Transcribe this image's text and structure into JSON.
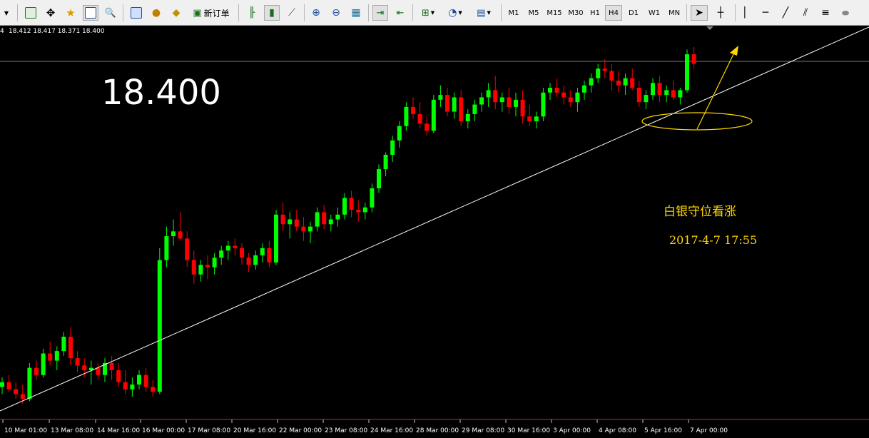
{
  "toolbar": {
    "new_order_label": "新订单",
    "timeframes": [
      "M1",
      "M5",
      "M15",
      "M30",
      "H1",
      "H4",
      "D1",
      "W1",
      "MN"
    ],
    "active_timeframe": "H4"
  },
  "chart": {
    "ohlc_header": "18.412 18.417 18.371 18.400",
    "ohlc_prefix": "4",
    "big_price": "18.400",
    "annotation_text": "白银守位看涨",
    "annotation_time": "2017-4-7   17:55",
    "x_tick_labels": [
      "10 Mar 01:00",
      "13 Mar 08:00",
      "14 Mar 16:00",
      "16 Mar 00:00",
      "17 Mar 08:00",
      "20 Mar 16:00",
      "22 Mar 00:00",
      "23 Mar 08:00",
      "24 Mar 16:00",
      "28 Mar 00:00",
      "29 Mar 08:00",
      "30 Mar 16:00",
      "3 Apr 00:00",
      "4 Apr 08:00",
      "5 Apr 16:00",
      "7 Apr 00:00"
    ],
    "colors": {
      "bull": "#00ff00",
      "bear": "#ff0000",
      "annotation": "#ffd700",
      "background": "#000000",
      "trendline": "#ffffff"
    }
  },
  "chart_data": {
    "type": "candlestick",
    "instrument_note": "silver H4",
    "current_price": 18.4,
    "price_line": 18.4,
    "last_bar": {
      "open": 18.412,
      "high": 18.417,
      "low": 18.371,
      "close": 18.4
    },
    "x_labels": [
      "10 Mar 01:00",
      "13 Mar 08:00",
      "14 Mar 16:00",
      "16 Mar 00:00",
      "17 Mar 08:00",
      "20 Mar 16:00",
      "22 Mar 00:00",
      "23 Mar 08:00",
      "24 Mar 16:00",
      "28 Mar 00:00",
      "29 Mar 08:00",
      "30 Mar 16:00",
      "3 Apr 00:00",
      "4 Apr 08:00",
      "5 Apr 16:00",
      "7 Apr 00:00"
    ],
    "candles": [
      [
        17.05,
        17.09,
        17.02,
        17.07
      ],
      [
        17.07,
        17.1,
        17.03,
        17.04
      ],
      [
        17.04,
        17.07,
        17.0,
        17.02
      ],
      [
        17.02,
        17.06,
        16.98,
        17.0
      ],
      [
        17.0,
        17.15,
        16.99,
        17.13
      ],
      [
        17.13,
        17.16,
        17.08,
        17.1
      ],
      [
        17.1,
        17.21,
        17.09,
        17.19
      ],
      [
        17.19,
        17.24,
        17.14,
        17.16
      ],
      [
        17.16,
        17.22,
        17.12,
        17.2
      ],
      [
        17.2,
        17.28,
        17.18,
        17.26
      ],
      [
        17.26,
        17.3,
        17.14,
        17.17
      ],
      [
        17.17,
        17.2,
        17.11,
        17.14
      ],
      [
        17.14,
        17.17,
        17.09,
        17.12
      ],
      [
        17.12,
        17.16,
        17.06,
        17.13
      ],
      [
        17.13,
        17.15,
        17.08,
        17.1
      ],
      [
        17.1,
        17.17,
        17.07,
        17.15
      ],
      [
        17.15,
        17.18,
        17.08,
        17.12
      ],
      [
        17.12,
        17.15,
        17.05,
        17.07
      ],
      [
        17.07,
        17.12,
        17.02,
        17.04
      ],
      [
        17.04,
        17.09,
        17.01,
        17.06
      ],
      [
        17.06,
        17.12,
        17.04,
        17.1
      ],
      [
        17.1,
        17.13,
        17.03,
        17.05
      ],
      [
        17.05,
        17.08,
        17.01,
        17.03
      ],
      [
        17.03,
        17.63,
        17.02,
        17.58
      ],
      [
        17.58,
        17.72,
        17.55,
        17.68
      ],
      [
        17.68,
        17.75,
        17.64,
        17.7
      ],
      [
        17.7,
        17.78,
        17.66,
        17.67
      ],
      [
        17.67,
        17.7,
        17.55,
        17.58
      ],
      [
        17.58,
        17.62,
        17.48,
        17.52
      ],
      [
        17.52,
        17.58,
        17.49,
        17.56
      ],
      [
        17.56,
        17.6,
        17.5,
        17.55
      ],
      [
        17.55,
        17.61,
        17.52,
        17.59
      ],
      [
        17.59,
        17.64,
        17.56,
        17.62
      ],
      [
        17.62,
        17.66,
        17.58,
        17.64
      ],
      [
        17.64,
        17.67,
        17.6,
        17.63
      ],
      [
        17.63,
        17.65,
        17.56,
        17.59
      ],
      [
        17.59,
        17.61,
        17.53,
        17.56
      ],
      [
        17.56,
        17.62,
        17.54,
        17.6
      ],
      [
        17.6,
        17.65,
        17.57,
        17.63
      ],
      [
        17.63,
        17.66,
        17.55,
        17.57
      ],
      [
        17.57,
        17.79,
        17.56,
        17.77
      ],
      [
        17.77,
        17.82,
        17.7,
        17.73
      ],
      [
        17.73,
        17.78,
        17.67,
        17.75
      ],
      [
        17.75,
        17.79,
        17.7,
        17.72
      ],
      [
        17.72,
        17.76,
        17.66,
        17.7
      ],
      [
        17.7,
        17.74,
        17.65,
        17.72
      ],
      [
        17.72,
        17.8,
        17.7,
        17.78
      ],
      [
        17.78,
        17.81,
        17.71,
        17.73
      ],
      [
        17.73,
        17.77,
        17.7,
        17.75
      ],
      [
        17.75,
        17.8,
        17.72,
        17.77
      ],
      [
        17.77,
        17.86,
        17.75,
        17.84
      ],
      [
        17.84,
        17.87,
        17.76,
        17.79
      ],
      [
        17.79,
        17.83,
        17.74,
        17.78
      ],
      [
        17.78,
        17.82,
        17.75,
        17.8
      ],
      [
        17.8,
        17.9,
        17.78,
        17.88
      ],
      [
        17.88,
        17.98,
        17.86,
        17.96
      ],
      [
        17.96,
        18.03,
        17.93,
        18.02
      ],
      [
        18.02,
        18.1,
        17.99,
        18.08
      ],
      [
        18.08,
        18.16,
        18.05,
        18.14
      ],
      [
        18.14,
        18.24,
        18.12,
        18.22
      ],
      [
        18.22,
        18.26,
        18.17,
        18.19
      ],
      [
        18.19,
        18.24,
        18.13,
        18.15
      ],
      [
        18.15,
        18.18,
        18.1,
        18.12
      ],
      [
        18.12,
        18.27,
        18.11,
        18.25
      ],
      [
        18.25,
        18.31,
        18.22,
        18.27
      ],
      [
        18.27,
        18.3,
        18.18,
        18.2
      ],
      [
        18.2,
        18.28,
        18.17,
        18.26
      ],
      [
        18.26,
        18.29,
        18.14,
        18.16
      ],
      [
        18.16,
        18.21,
        18.13,
        18.19
      ],
      [
        18.19,
        18.25,
        18.16,
        18.23
      ],
      [
        18.23,
        18.28,
        18.2,
        18.26
      ],
      [
        18.26,
        18.32,
        18.22,
        18.29
      ],
      [
        18.29,
        18.35,
        18.21,
        18.24
      ],
      [
        18.24,
        18.28,
        18.2,
        18.26
      ],
      [
        18.26,
        18.3,
        18.19,
        18.22
      ],
      [
        18.22,
        18.28,
        18.18,
        18.25
      ],
      [
        18.25,
        18.29,
        18.15,
        18.18
      ],
      [
        18.18,
        18.23,
        18.14,
        18.16
      ],
      [
        18.16,
        18.2,
        18.13,
        18.18
      ],
      [
        18.18,
        18.3,
        18.16,
        18.28
      ],
      [
        18.28,
        18.32,
        18.25,
        18.3
      ],
      [
        18.3,
        18.34,
        18.26,
        18.28
      ],
      [
        18.28,
        18.31,
        18.23,
        18.26
      ],
      [
        18.26,
        18.29,
        18.22,
        18.24
      ],
      [
        18.24,
        18.3,
        18.2,
        18.28
      ],
      [
        18.28,
        18.33,
        18.25,
        18.31
      ],
      [
        18.31,
        18.36,
        18.28,
        18.34
      ],
      [
        18.34,
        18.4,
        18.32,
        18.38
      ],
      [
        18.38,
        18.42,
        18.34,
        18.37
      ],
      [
        18.37,
        18.4,
        18.29,
        18.33
      ],
      [
        18.33,
        18.37,
        18.28,
        18.31
      ],
      [
        18.31,
        18.36,
        18.27,
        18.34
      ],
      [
        18.34,
        18.38,
        18.29,
        18.3
      ],
      [
        18.3,
        18.33,
        18.22,
        18.24
      ],
      [
        18.24,
        18.29,
        18.21,
        18.27
      ],
      [
        18.27,
        18.34,
        18.25,
        18.32
      ],
      [
        18.32,
        18.35,
        18.24,
        18.27
      ],
      [
        18.27,
        18.31,
        18.24,
        18.29
      ],
      [
        18.29,
        18.33,
        18.25,
        18.26
      ],
      [
        18.26,
        18.3,
        18.23,
        18.29
      ],
      [
        18.29,
        18.46,
        18.28,
        18.44
      ],
      [
        18.44,
        18.47,
        18.38,
        18.4
      ]
    ],
    "trendline": {
      "from": {
        "bar": 0,
        "price": 17.02
      },
      "to": {
        "bar": 101,
        "price": 18.38
      }
    }
  }
}
